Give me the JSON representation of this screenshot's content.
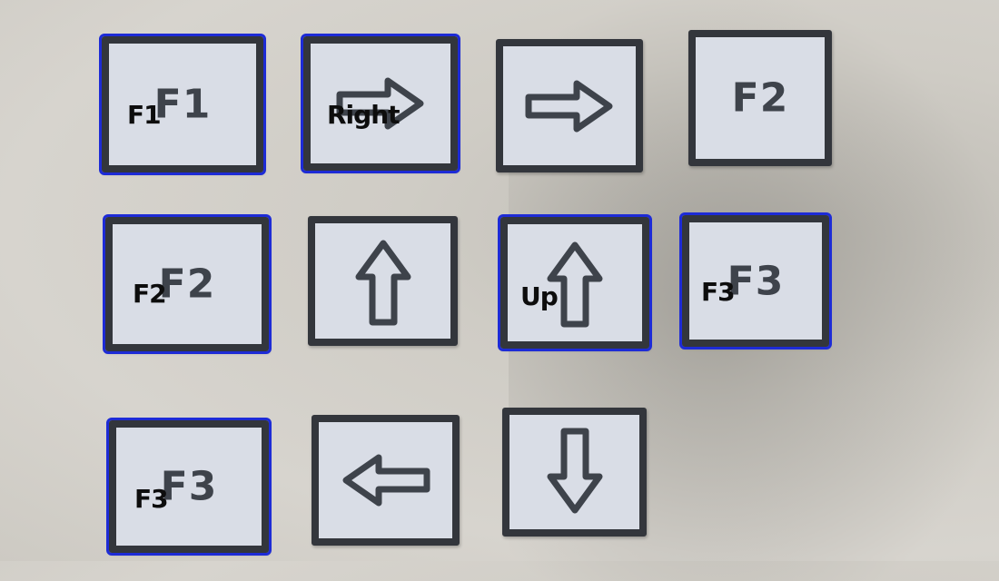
{
  "cards": [
    {
      "printed": "F1",
      "overlay": "F1"
    },
    {
      "printed": "",
      "icon": "right-arrow-icon",
      "overlay": "Right"
    },
    {
      "printed": "",
      "icon": "right-arrow-icon",
      "overlay": ""
    },
    {
      "printed": "F2",
      "overlay": ""
    },
    {
      "printed": "F2",
      "overlay": "F2"
    },
    {
      "printed": "",
      "icon": "up-arrow-icon",
      "overlay": ""
    },
    {
      "printed": "",
      "icon": "up-arrow-icon",
      "overlay": "Up"
    },
    {
      "printed": "F3",
      "overlay": "F3"
    },
    {
      "printed": "F3",
      "overlay": "F3"
    },
    {
      "printed": "",
      "icon": "left-arrow-icon",
      "overlay": ""
    },
    {
      "printed": "",
      "icon": "down-arrow-icon",
      "overlay": ""
    }
  ],
  "colors": {
    "detection_box": "#1d2bd6",
    "card_border": "#33363c",
    "card_face": "#d9dde6"
  }
}
